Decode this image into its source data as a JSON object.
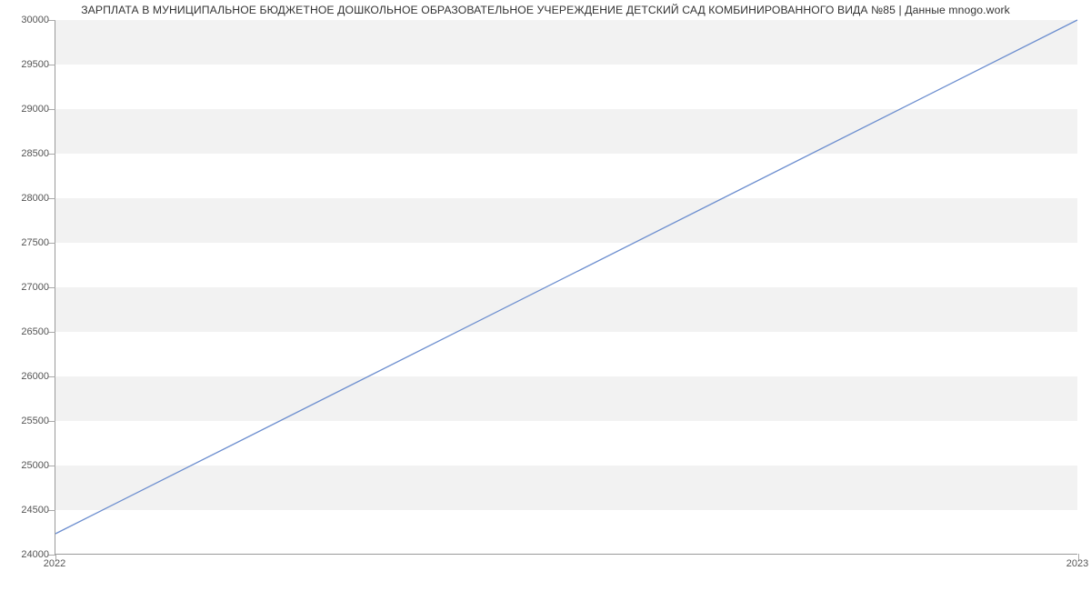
{
  "chart_data": {
    "type": "line",
    "title": "ЗАРПЛАТА В МУНИЦИПАЛЬНОЕ БЮДЖЕТНОЕ ДОШКОЛЬНОЕ ОБРАЗОВАТЕЛЬНОЕ УЧЕРЕЖДЕНИЕ ДЕТСКИЙ САД КОМБИНИРОВАННОГО ВИДА №85 | Данные mnogo.work",
    "x": [
      "2022",
      "2023"
    ],
    "values": [
      24225,
      30000
    ],
    "xlabel": "",
    "ylabel": "",
    "ylim": [
      24000,
      30000
    ],
    "y_ticks": [
      24000,
      24500,
      25000,
      25500,
      26000,
      26500,
      27000,
      27500,
      28000,
      28500,
      29000,
      29500,
      30000
    ],
    "x_ticks": [
      "2022",
      "2023"
    ],
    "grid": "banded",
    "line_color": "#6c8ecf"
  }
}
